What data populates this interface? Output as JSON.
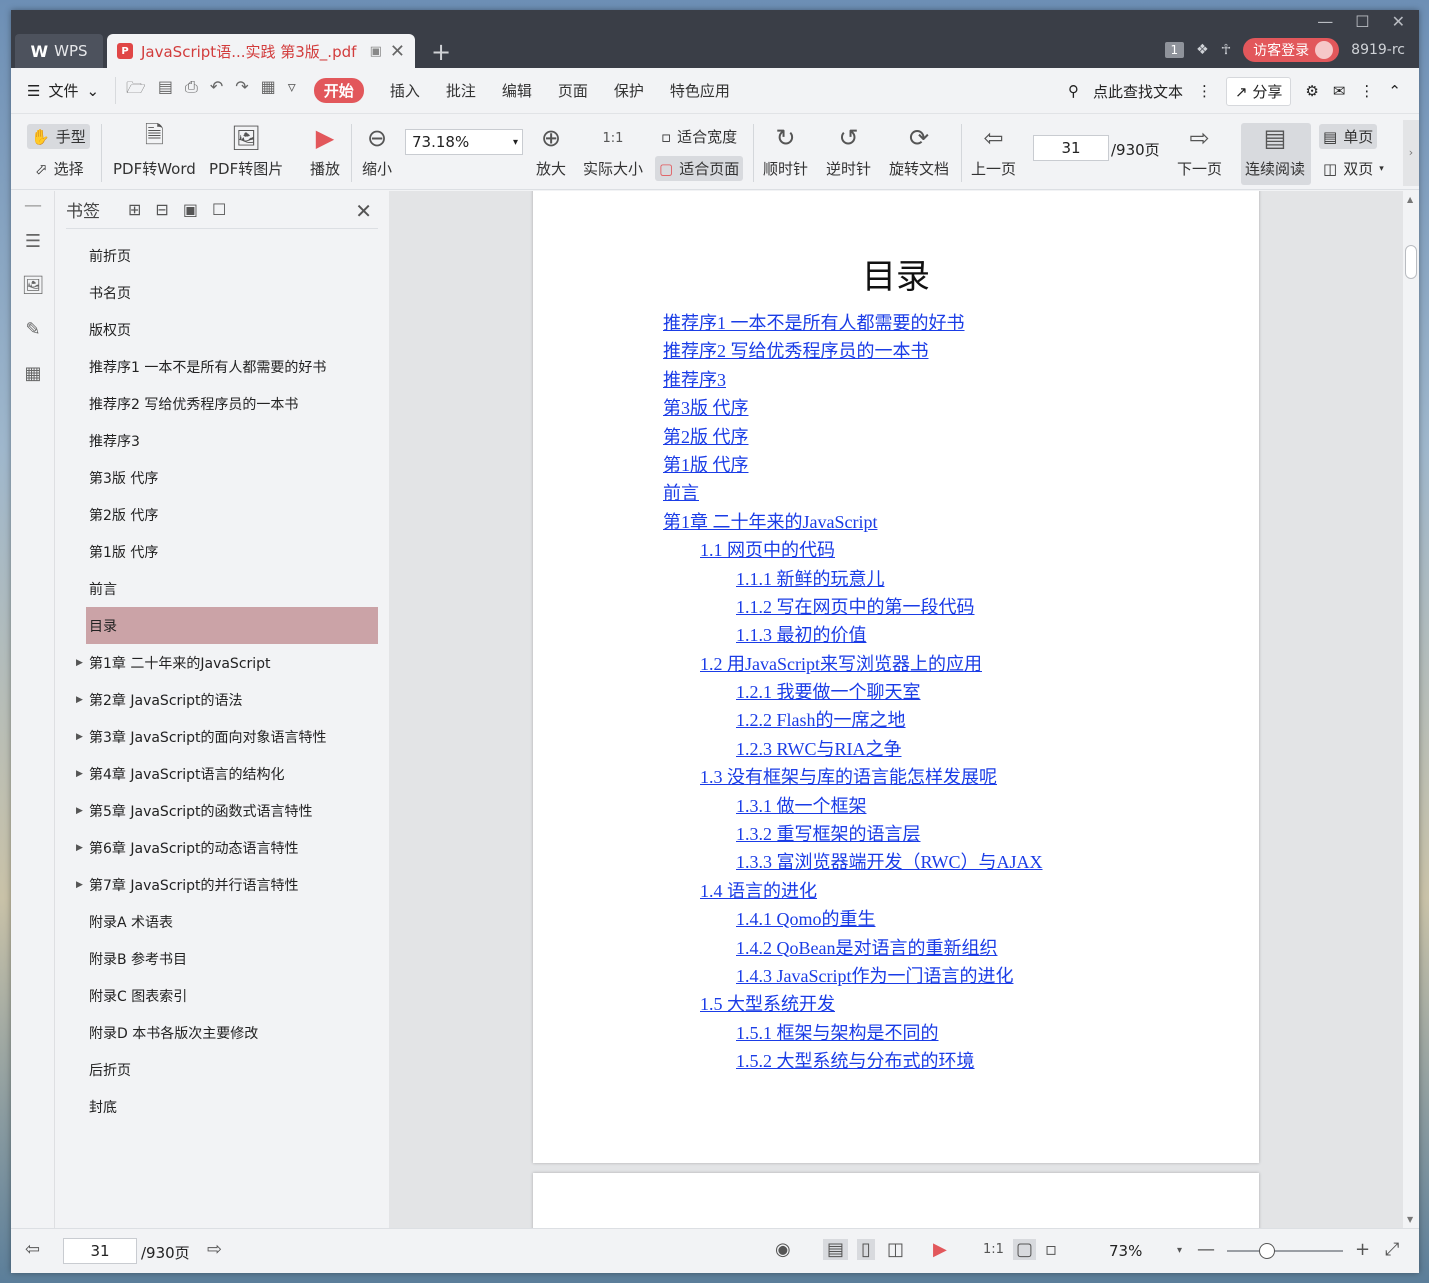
{
  "titlebar": {
    "app_tab": "WPS",
    "doc_tab": "JavaScript语...实践 第3版_.pdf",
    "page_count_badge": "1",
    "login_label": "访客登录",
    "user_id": "8919-rc"
  },
  "menu": {
    "file_label": "文件",
    "items": [
      "开始",
      "插入",
      "批注",
      "编辑",
      "页面",
      "保护",
      "特色应用"
    ],
    "search_label": "点此查找文本",
    "share_label": "分享"
  },
  "ribbon": {
    "hand": "手型",
    "select": "选择",
    "pdf_to_word": "PDF转Word",
    "pdf_to_image": "PDF转图片",
    "play": "播放",
    "zoom_out": "缩小",
    "zoom_value": "73.18%",
    "zoom_in": "放大",
    "actual_size": "实际大小",
    "fit_width": "适合宽度",
    "fit_page": "适合页面",
    "clockwise": "顺时针",
    "counterclockwise": "逆时针",
    "rotate_doc": "旋转文档",
    "prev_page": "上一页",
    "current_page": "31",
    "total_pages": "/930页",
    "next_page": "下一页",
    "continuous": "连续阅读",
    "single": "单页",
    "double": "双页"
  },
  "bookmark_panel": {
    "title": "书签",
    "items": [
      {
        "label": "前折页",
        "expandable": false,
        "selected": false
      },
      {
        "label": "书名页",
        "expandable": false,
        "selected": false
      },
      {
        "label": "版权页",
        "expandable": false,
        "selected": false
      },
      {
        "label": "推荐序1 一本不是所有人都需要的好书",
        "expandable": false,
        "selected": false
      },
      {
        "label": "推荐序2 写给优秀程序员的一本书",
        "expandable": false,
        "selected": false
      },
      {
        "label": "推荐序3",
        "expandable": false,
        "selected": false
      },
      {
        "label": "第3版 代序",
        "expandable": false,
        "selected": false
      },
      {
        "label": "第2版 代序",
        "expandable": false,
        "selected": false
      },
      {
        "label": "第1版 代序",
        "expandable": false,
        "selected": false
      },
      {
        "label": "前言",
        "expandable": false,
        "selected": false
      },
      {
        "label": "目录",
        "expandable": false,
        "selected": true
      },
      {
        "label": "第1章 二十年来的JavaScript",
        "expandable": true,
        "selected": false
      },
      {
        "label": "第2章 JavaScript的语法",
        "expandable": true,
        "selected": false
      },
      {
        "label": "第3章 JavaScript的面向对象语言特性",
        "expandable": true,
        "selected": false
      },
      {
        "label": "第4章 JavaScript语言的结构化",
        "expandable": true,
        "selected": false
      },
      {
        "label": "第5章 JavaScript的函数式语言特性",
        "expandable": true,
        "selected": false
      },
      {
        "label": "第6章 JavaScript的动态语言特性",
        "expandable": true,
        "selected": false
      },
      {
        "label": "第7章 JavaScript的并行语言特性",
        "expandable": true,
        "selected": false
      },
      {
        "label": "附录A 术语表",
        "expandable": false,
        "selected": false
      },
      {
        "label": "附录B 参考书目",
        "expandable": false,
        "selected": false
      },
      {
        "label": "附录C 图表索引",
        "expandable": false,
        "selected": false
      },
      {
        "label": "附录D 本书各版次主要修改",
        "expandable": false,
        "selected": false
      },
      {
        "label": "后折页",
        "expandable": false,
        "selected": false
      },
      {
        "label": "封底",
        "expandable": false,
        "selected": false
      }
    ]
  },
  "document": {
    "toc_title": "目录",
    "toc": [
      {
        "text": "推荐序1 一本不是所有人都需要的好书",
        "level": 1
      },
      {
        "text": "推荐序2 写给优秀程序员的一本书",
        "level": 1
      },
      {
        "text": "推荐序3",
        "level": 1
      },
      {
        "text": "第3版 代序",
        "level": 1
      },
      {
        "text": "第2版 代序",
        "level": 1
      },
      {
        "text": "第1版 代序",
        "level": 1
      },
      {
        "text": "前言",
        "level": 1
      },
      {
        "text": "第1章 二十年来的JavaScript",
        "level": 1
      },
      {
        "text": "1.1 网页中的代码",
        "level": 2
      },
      {
        "text": "1.1.1 新鲜的玩意儿",
        "level": 3
      },
      {
        "text": "1.1.2 写在网页中的第一段代码",
        "level": 3
      },
      {
        "text": "1.1.3 最初的价值",
        "level": 3
      },
      {
        "text": "1.2 用JavaScript来写浏览器上的应用",
        "level": 2
      },
      {
        "text": "1.2.1 我要做一个聊天室",
        "level": 3
      },
      {
        "text": "1.2.2 Flash的一席之地",
        "level": 3
      },
      {
        "text": "1.2.3 RWC与RIA之争",
        "level": 3
      },
      {
        "text": "1.3 没有框架与库的语言能怎样发展呢",
        "level": 2
      },
      {
        "text": "1.3.1 做一个框架",
        "level": 3
      },
      {
        "text": "1.3.2 重写框架的语言层",
        "level": 3
      },
      {
        "text": "1.3.3 富浏览器端开发（RWC）与AJAX",
        "level": 3
      },
      {
        "text": "1.4 语言的进化",
        "level": 2
      },
      {
        "text": "1.4.1 Qomo的重生",
        "level": 3
      },
      {
        "text": "1.4.2 QoBean是对语言的重新组织",
        "level": 3
      },
      {
        "text": "1.4.3 JavaScript作为一门语言的进化",
        "level": 3
      },
      {
        "text": "1.5 大型系统开发",
        "level": 2
      },
      {
        "text": "1.5.1 框架与架构是不同的",
        "level": 3
      },
      {
        "text": "1.5.2 大型系统与分布式的环境",
        "level": 3
      }
    ]
  },
  "statusbar": {
    "current_page": "31",
    "total_pages": "/930页",
    "zoom": "73%"
  },
  "colors": {
    "accent": "#e2575b",
    "link": "#1a3ce6",
    "selected_bookmark": "#cba3a7"
  }
}
